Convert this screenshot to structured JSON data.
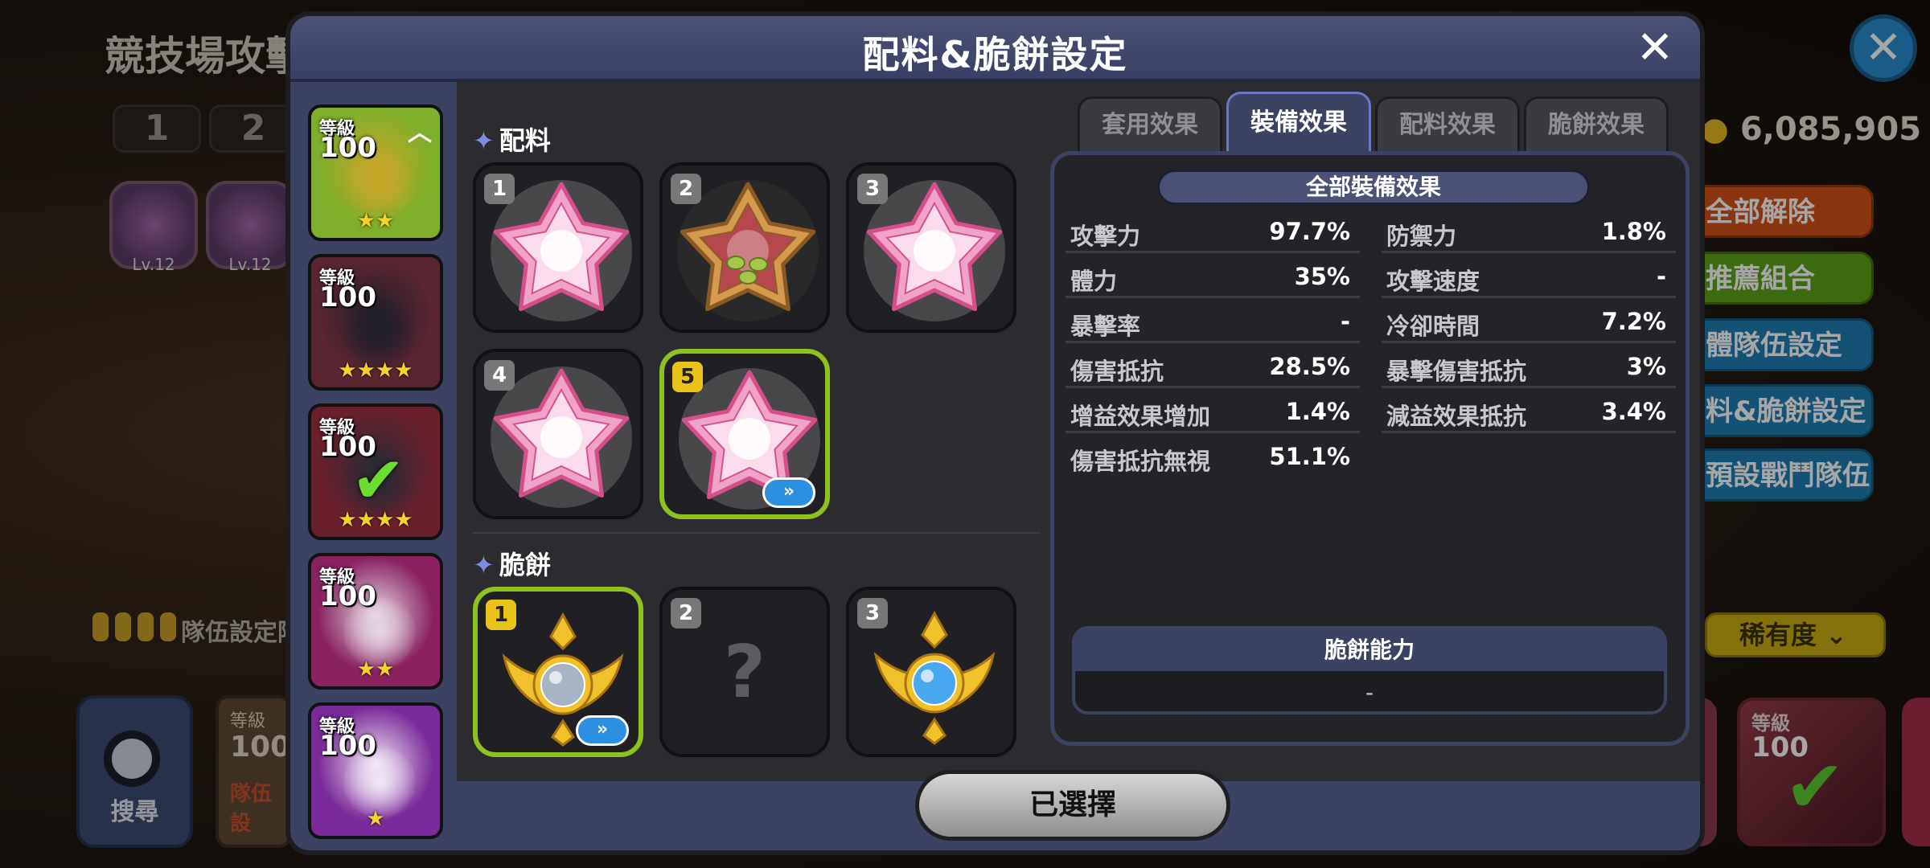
{
  "background": {
    "title": "競技場攻擊",
    "tabs": [
      "1",
      "2"
    ],
    "ingredient_levels": [
      "Lv.12",
      "Lv.12"
    ],
    "team_label": "隊伍設定階",
    "search_label": "搜尋",
    "card_level_label": "等級",
    "card_level": "100",
    "card_team_label": "隊伍設",
    "coins": "6,085,905",
    "buttons": [
      "全部解除",
      "推薦組合",
      "體隊伍設定",
      "料&脆餅設定",
      "預設戰鬥隊伍"
    ],
    "rarity": "稀有度"
  },
  "dialog": {
    "title": "配料&脆餅設定",
    "close_icon": "close-icon"
  },
  "cookies": [
    {
      "level_label": "等級",
      "level": "100",
      "stars": "★★",
      "extra": "︿",
      "bg": "#7fae2a",
      "figure": "#c9a72a"
    },
    {
      "level_label": "等級",
      "level": "100",
      "stars": "★★★★",
      "extra": "",
      "bg": "#5a2530",
      "figure": "#1f1f2a"
    },
    {
      "level_label": "等級",
      "level": "100",
      "stars": "★★★★",
      "extra": "",
      "bg": "#6a1f2d",
      "figure": "#2a2a33",
      "checked": true
    },
    {
      "level_label": "等級",
      "level": "100",
      "stars": "★★",
      "extra": "",
      "bg": "#8a2260",
      "figure": "#e6d7e3"
    },
    {
      "level_label": "等級",
      "level": "100",
      "stars": "★",
      "extra": "",
      "bg": "#7a2a9a",
      "figure": "#f1e7f4"
    }
  ],
  "toppings": {
    "label": "配料",
    "slots": [
      {
        "num": "1",
        "variant": "pink"
      },
      {
        "num": "2",
        "variant": "choco"
      },
      {
        "num": "3",
        "variant": "pink"
      },
      {
        "num": "4",
        "variant": "pink"
      },
      {
        "num": "5",
        "variant": "pink",
        "selected": true,
        "arrow": "»"
      }
    ]
  },
  "crisps": {
    "label": "脆餅",
    "slots": [
      {
        "num": "1",
        "variant": "silver",
        "selected": true,
        "arrow": "»"
      },
      {
        "num": "2",
        "variant": "empty",
        "mark": "?"
      },
      {
        "num": "3",
        "variant": "blue"
      }
    ]
  },
  "tabs": [
    {
      "label": "套用效果",
      "active": false
    },
    {
      "label": "裝備效果",
      "active": true
    },
    {
      "label": "配料效果",
      "active": false
    },
    {
      "label": "脆餅效果",
      "active": false
    }
  ],
  "stats": {
    "header": "全部裝備效果",
    "left": [
      {
        "k": "攻擊力",
        "v": "97.7%"
      },
      {
        "k": "體力",
        "v": "35%"
      },
      {
        "k": "暴擊率",
        "v": "-"
      },
      {
        "k": "傷害抵抗",
        "v": "28.5%"
      },
      {
        "k": "增益效果增加",
        "v": "1.4%"
      },
      {
        "k": "傷害抵抗無視",
        "v": "51.1%"
      }
    ],
    "right": [
      {
        "k": "防禦力",
        "v": "1.8%"
      },
      {
        "k": "攻擊速度",
        "v": "-"
      },
      {
        "k": "冷卻時間",
        "v": "7.2%"
      },
      {
        "k": "暴擊傷害抵抗",
        "v": "3%"
      },
      {
        "k": "減益效果抵抗",
        "v": "3.4%"
      }
    ],
    "crisp_ability_label": "脆餅能力",
    "crisp_ability_value": "-"
  },
  "footer": {
    "select_button": "已選擇"
  }
}
